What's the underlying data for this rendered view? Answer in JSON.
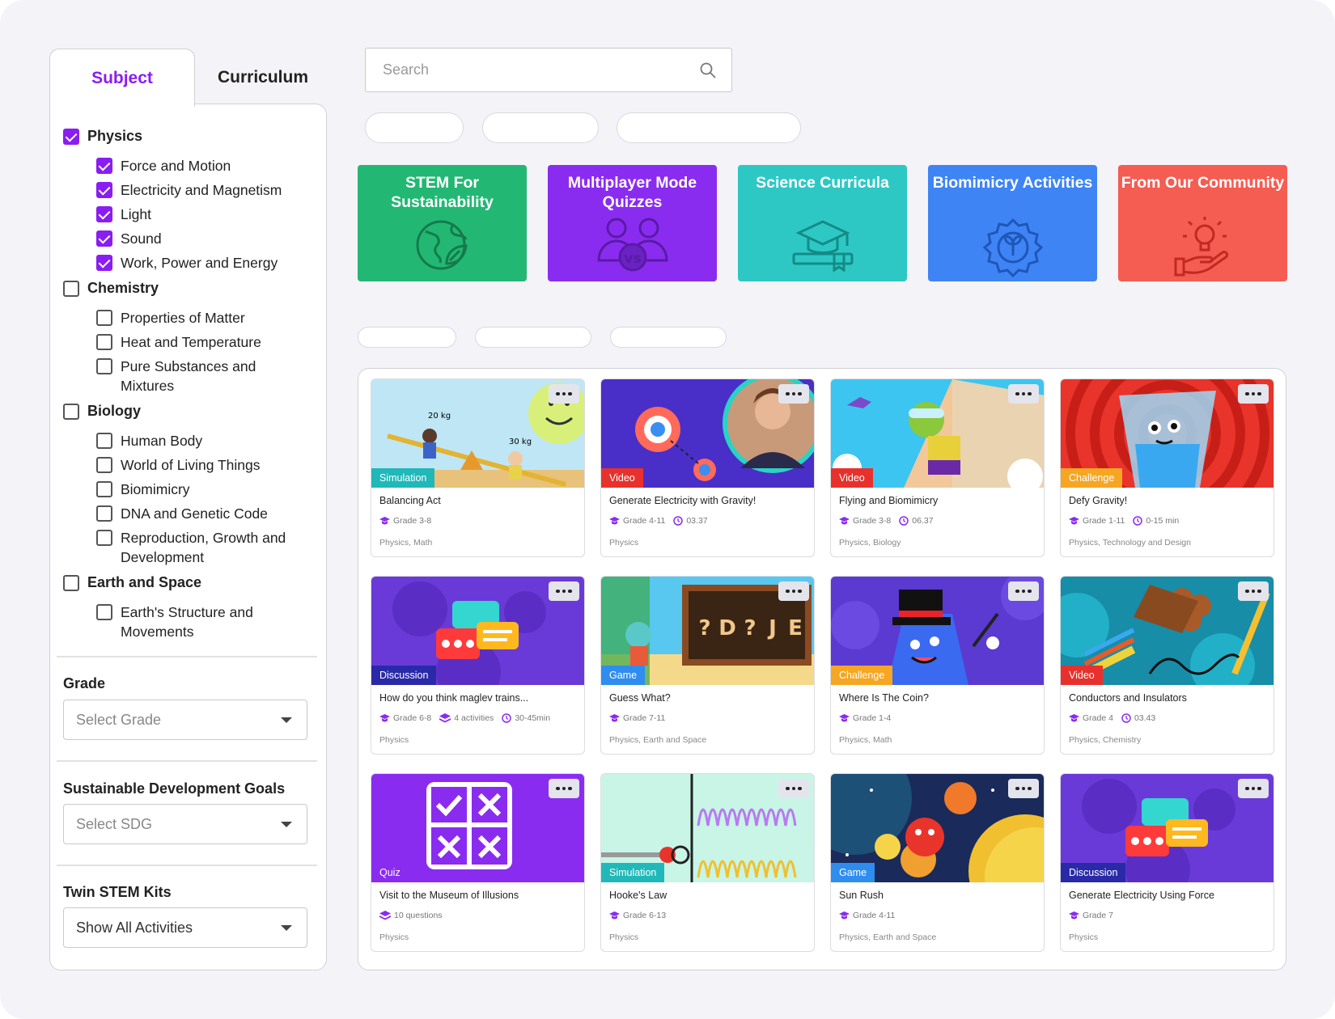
{
  "tabs": {
    "subject": "Subject",
    "curriculum": "Curriculum"
  },
  "sidebar": {
    "categories": [
      {
        "label": "Physics",
        "checked": true,
        "items": [
          {
            "label": "Force and Motion",
            "checked": true
          },
          {
            "label": "Electricity and Magnetism",
            "checked": true
          },
          {
            "label": "Light",
            "checked": true
          },
          {
            "label": "Sound",
            "checked": true
          },
          {
            "label": "Work, Power and Energy",
            "checked": true
          }
        ]
      },
      {
        "label": "Chemistry",
        "checked": false,
        "items": [
          {
            "label": "Properties of Matter",
            "checked": false
          },
          {
            "label": "Heat and Temperature",
            "checked": false
          },
          {
            "label": "Pure Substances and Mixtures",
            "checked": false
          }
        ]
      },
      {
        "label": "Biology",
        "checked": false,
        "items": [
          {
            "label": "Human Body",
            "checked": false
          },
          {
            "label": "World of Living Things",
            "checked": false
          },
          {
            "label": "Biomimicry",
            "checked": false
          },
          {
            "label": "DNA and Genetic Code",
            "checked": false
          },
          {
            "label": "Reproduction, Growth and Development",
            "checked": false
          }
        ]
      },
      {
        "label": "Earth and Space",
        "checked": false,
        "items": [
          {
            "label": "Earth's Structure and Movements",
            "checked": false
          }
        ]
      }
    ],
    "grade": {
      "title": "Grade",
      "value": "Select Grade"
    },
    "sdg": {
      "title": "Sustainable Development Goals",
      "value": "Select SDG"
    },
    "kits": {
      "title": "Twin STEM Kits",
      "value": "Show All Activities"
    }
  },
  "search": {
    "placeholder": "Search"
  },
  "tiles": [
    {
      "title": "STEM For Sustainability",
      "color": "#22b873",
      "icon": "globe-leaf-icon"
    },
    {
      "title": "Multiplayer Mode Quizzes",
      "color": "#8a2cf0",
      "icon": "versus-users-icon"
    },
    {
      "title": "Science Curricula",
      "color": "#2ec8c4",
      "icon": "graduation-book-icon"
    },
    {
      "title": "Biomimicry Activities",
      "color": "#3e84f5",
      "icon": "gear-leaf-icon"
    },
    {
      "title": "From Our Community",
      "color": "#f55c52",
      "icon": "lightbulb-hand-icon"
    }
  ],
  "cards": [
    {
      "title": "Balancing Act",
      "badge": "Simulation",
      "badge_color": "#20b8b8",
      "grade": "Grade 3-8",
      "extra": [],
      "subjects": "Physics, Math"
    },
    {
      "title": "Generate Electricity with Gravity!",
      "badge": "Video",
      "badge_color": "#e8312c",
      "grade": "Grade 4-11",
      "extra": [
        {
          "icon": "clock-icon",
          "text": "03.37"
        }
      ],
      "subjects": "Physics"
    },
    {
      "title": "Flying and Biomimicry",
      "badge": "Video",
      "badge_color": "#e8312c",
      "grade": "Grade 3-8",
      "extra": [
        {
          "icon": "clock-icon",
          "text": "06.37"
        }
      ],
      "subjects": "Physics, Biology"
    },
    {
      "title": "Defy Gravity!",
      "badge": "Challenge",
      "badge_color": "#f5a623",
      "grade": "Grade 1-11",
      "extra": [
        {
          "icon": "clock-icon",
          "text": "0-15 min"
        }
      ],
      "subjects": "Physics, Technology and Design"
    },
    {
      "title": "How do you think maglev trains...",
      "badge": "Discussion",
      "badge_color": "#2a2aa8",
      "grade": "Grade 6-8",
      "extra": [
        {
          "icon": "layers-icon",
          "text": "4 activities"
        },
        {
          "icon": "clock-icon",
          "text": "30-45min"
        }
      ],
      "subjects": "Physics"
    },
    {
      "title": "Guess What?",
      "badge": "Game",
      "badge_color": "#2f8df0",
      "grade": "Grade 7-11",
      "extra": [],
      "subjects": "Physics, Earth and Space"
    },
    {
      "title": "Where Is The Coin?",
      "badge": "Challenge",
      "badge_color": "#f5a623",
      "grade": "Grade 1-4",
      "extra": [],
      "subjects": "Physics, Math"
    },
    {
      "title": "Conductors and Insulators",
      "badge": "Video",
      "badge_color": "#e8312c",
      "grade": "Grade 4",
      "extra": [
        {
          "icon": "clock-icon",
          "text": "03.43"
        }
      ],
      "subjects": "Physics, Chemistry"
    },
    {
      "title": "Visit to the Museum of Illusions",
      "badge": "Quiz",
      "badge_color": "#8a2cf0",
      "grade": "",
      "extra": [],
      "questions": "10 questions",
      "subjects": "Physics"
    },
    {
      "title": "Hooke's Law",
      "badge": "Simulation",
      "badge_color": "#20b8b8",
      "grade": "Grade 6-13",
      "extra": [],
      "subjects": "Physics"
    },
    {
      "title": "Sun Rush",
      "badge": "Game",
      "badge_color": "#2f8df0",
      "grade": "Grade 4-11",
      "extra": [],
      "subjects": "Physics, Earth and Space"
    },
    {
      "title": "Generate Electricity Using Force",
      "badge": "Discussion",
      "badge_color": "#2a2aa8",
      "grade": "Grade 7",
      "extra": [],
      "subjects": "Physics"
    }
  ],
  "card_thumbnails": {
    "guess_letters": [
      "?",
      "D",
      "?",
      "J",
      "E"
    ]
  },
  "colors": {
    "accent": "#8a1df2",
    "meta_icon": "#8a2cf0"
  }
}
